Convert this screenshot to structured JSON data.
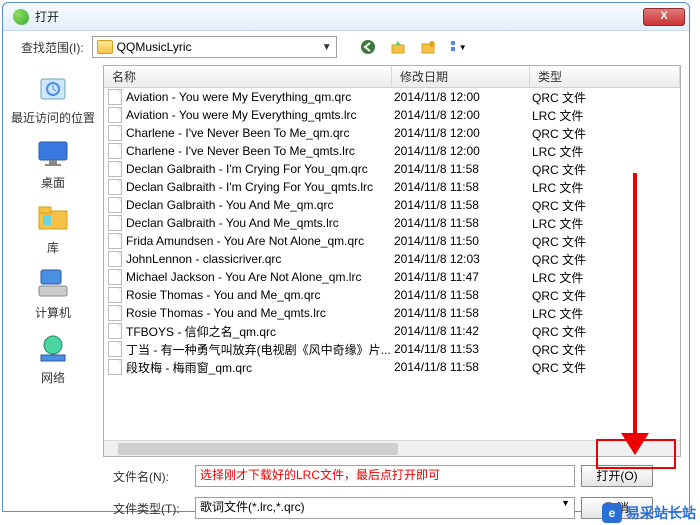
{
  "titlebar": {
    "title": "打开",
    "close": "X"
  },
  "toolbar": {
    "scope_label": "查找范围(I):",
    "path": "QQMusicLyric"
  },
  "sidebar": [
    {
      "label": "最近访问的位置"
    },
    {
      "label": "桌面"
    },
    {
      "label": "库"
    },
    {
      "label": "计算机"
    },
    {
      "label": "网络"
    }
  ],
  "columns": {
    "name": "名称",
    "date": "修改日期",
    "type": "类型"
  },
  "files": [
    {
      "name": "Aviation - You were My Everything_qm.qrc",
      "date": "2014/11/8 12:00",
      "type": "QRC 文件"
    },
    {
      "name": "Aviation - You were My Everything_qmts.lrc",
      "date": "2014/11/8 12:00",
      "type": "LRC 文件"
    },
    {
      "name": "Charlene - I've Never Been To Me_qm.qrc",
      "date": "2014/11/8 12:00",
      "type": "QRC 文件"
    },
    {
      "name": "Charlene - I've Never Been To Me_qmts.lrc",
      "date": "2014/11/8 12:00",
      "type": "LRC 文件"
    },
    {
      "name": "Declan Galbraith - I'm Crying For You_qm.qrc",
      "date": "2014/11/8 11:58",
      "type": "QRC 文件"
    },
    {
      "name": "Declan Galbraith - I'm Crying For You_qmts.lrc",
      "date": "2014/11/8 11:58",
      "type": "LRC 文件"
    },
    {
      "name": "Declan Galbraith - You And Me_qm.qrc",
      "date": "2014/11/8 11:58",
      "type": "QRC 文件"
    },
    {
      "name": "Declan Galbraith - You And Me_qmts.lrc",
      "date": "2014/11/8 11:58",
      "type": "LRC 文件"
    },
    {
      "name": "Frida Amundsen - You Are Not Alone_qm.qrc",
      "date": "2014/11/8 11:50",
      "type": "QRC 文件"
    },
    {
      "name": "JohnLennon - classicriver.qrc",
      "date": "2014/11/8 12:03",
      "type": "QRC 文件"
    },
    {
      "name": "Michael Jackson - You Are Not Alone_qm.lrc",
      "date": "2014/11/8 11:47",
      "type": "LRC 文件"
    },
    {
      "name": "Rosie Thomas - You and Me_qm.qrc",
      "date": "2014/11/8 11:58",
      "type": "QRC 文件"
    },
    {
      "name": "Rosie Thomas - You and Me_qmts.lrc",
      "date": "2014/11/8 11:58",
      "type": "LRC 文件"
    },
    {
      "name": "TFBOYS - 信仰之名_qm.qrc",
      "date": "2014/11/8 11:42",
      "type": "QRC 文件"
    },
    {
      "name": "丁当 - 有一种勇气叫放弃(电视剧《风中奇缘》片...",
      "date": "2014/11/8 11:53",
      "type": "QRC 文件"
    },
    {
      "name": "段玫梅 - 梅雨窗_qm.qrc",
      "date": "2014/11/8 11:58",
      "type": "QRC 文件"
    }
  ],
  "bottom": {
    "filename_label": "文件名(N):",
    "filename_value": "选择刚才下载好的LRC文件，最后点打开即可",
    "filetype_label": "文件类型(T):",
    "filetype_value": "歌词文件(*.lrc,*.qrc)",
    "open_btn": "打开(O)",
    "cancel_btn": "取消"
  },
  "watermark": {
    "logo": "e",
    "text": "易采站长站"
  }
}
